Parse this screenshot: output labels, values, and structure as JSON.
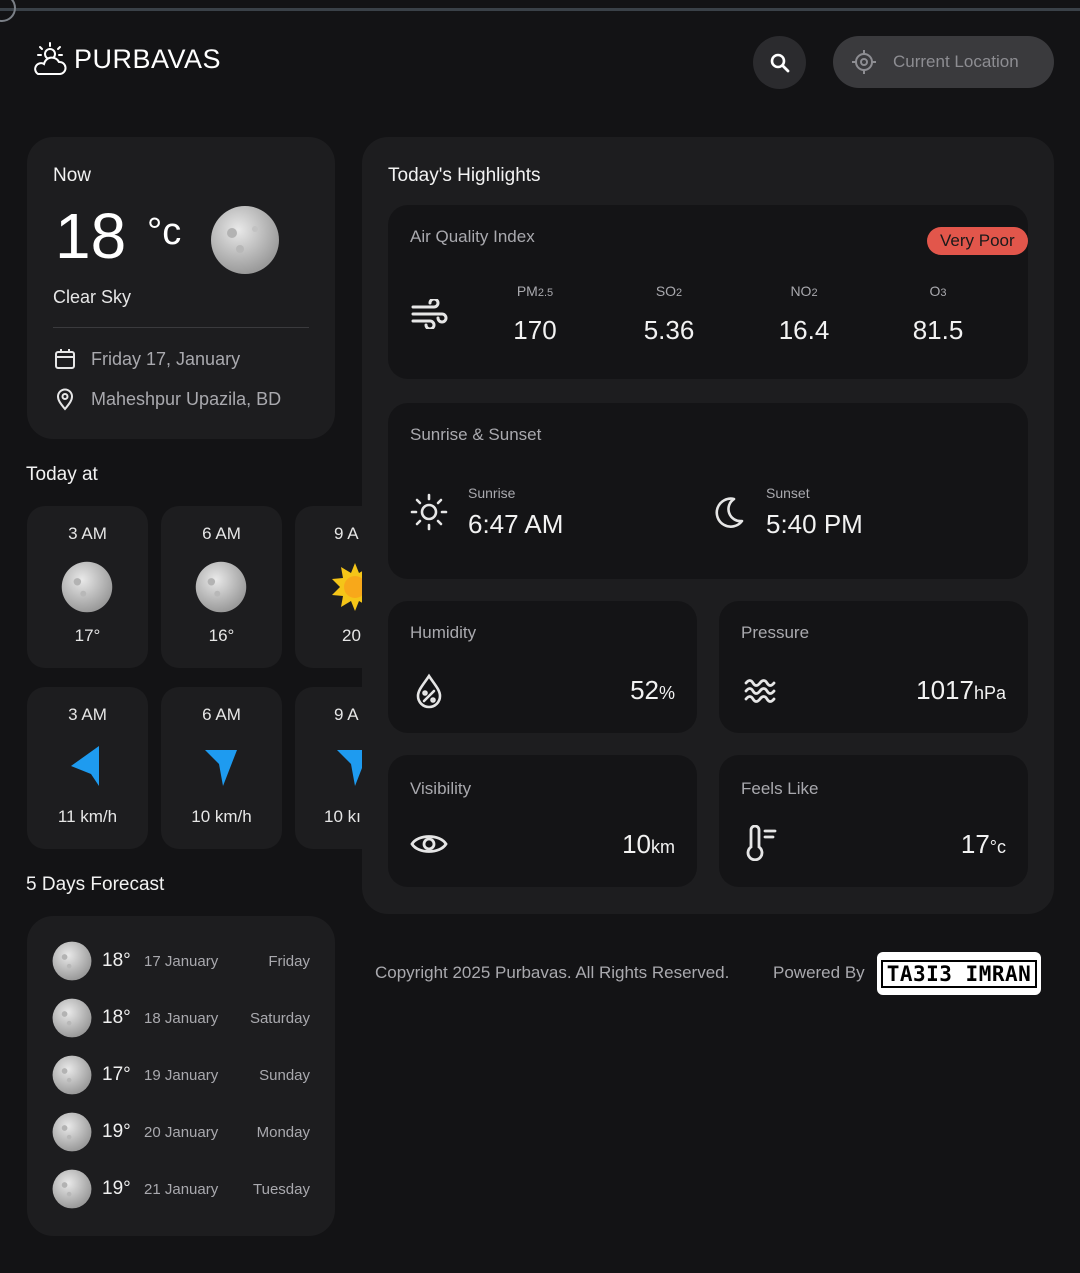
{
  "header": {
    "brand": "PURBAVAS",
    "location_button": "Current Location"
  },
  "now": {
    "title": "Now",
    "temp": "18",
    "unit": "°c",
    "desc": "Clear Sky",
    "date": "Friday 17, January",
    "location": "Maheshpur Upazila, BD"
  },
  "today": {
    "title": "Today at",
    "temps": [
      {
        "time": "3 AM",
        "value": "17°",
        "icon": "moon-icon"
      },
      {
        "time": "6 AM",
        "value": "16°",
        "icon": "moon-icon"
      },
      {
        "time": "9 A",
        "value": "20",
        "icon": "sun-icon"
      }
    ],
    "winds": [
      {
        "time": "3 AM",
        "value": "11 km/h",
        "icon": "wind-direction-icon"
      },
      {
        "time": "6 AM",
        "value": "10 km/h",
        "icon": "wind-direction-icon"
      },
      {
        "time": "9 A",
        "value": "10 kı",
        "icon": "wind-direction-icon"
      }
    ]
  },
  "forecast": {
    "title": "5 Days Forecast",
    "days": [
      {
        "temp": "18°",
        "date": "17 January",
        "day": "Friday"
      },
      {
        "temp": "18°",
        "date": "18 January",
        "day": "Saturday"
      },
      {
        "temp": "17°",
        "date": "19 January",
        "day": "Sunday"
      },
      {
        "temp": "19°",
        "date": "20 January",
        "day": "Monday"
      },
      {
        "temp": "19°",
        "date": "21 January",
        "day": "Tuesday"
      }
    ]
  },
  "highlights": {
    "title": "Today's Highlights",
    "aqi": {
      "label": "Air Quality Index",
      "badge": "Very Poor",
      "items": [
        {
          "key": "PM",
          "sub": "2.5",
          "value": "170"
        },
        {
          "key": "SO",
          "sub": "2",
          "value": "5.36"
        },
        {
          "key": "NO",
          "sub": "2",
          "value": "16.4"
        },
        {
          "key": "O",
          "sub": "3",
          "value": "81.5"
        }
      ]
    },
    "sun": {
      "label": "Sunrise & Sunset",
      "sunrise_label": "Sunrise",
      "sunrise": "6:47 AM",
      "sunset_label": "Sunset",
      "sunset": "5:40 PM"
    },
    "humidity": {
      "label": "Humidity",
      "value": "52",
      "unit": "%"
    },
    "pressure": {
      "label": "Pressure",
      "value": "1017",
      "unit": "hPa"
    },
    "visibility": {
      "label": "Visibility",
      "value": "10",
      "unit": "km"
    },
    "feels_like": {
      "label": "Feels Like",
      "value": "17",
      "unit": "°c"
    }
  },
  "footer": {
    "copyright": "Copyright 2025 Purbavas. All Rights Reserved.",
    "powered": "Powered By",
    "logo_text": "TA3I3 IMRAN"
  },
  "colors": {
    "background": "#131315",
    "card": "#1d1d1f",
    "badge": "#e2564b",
    "wind_arrow": "#1e9bf0",
    "sun": "#f5c518"
  }
}
